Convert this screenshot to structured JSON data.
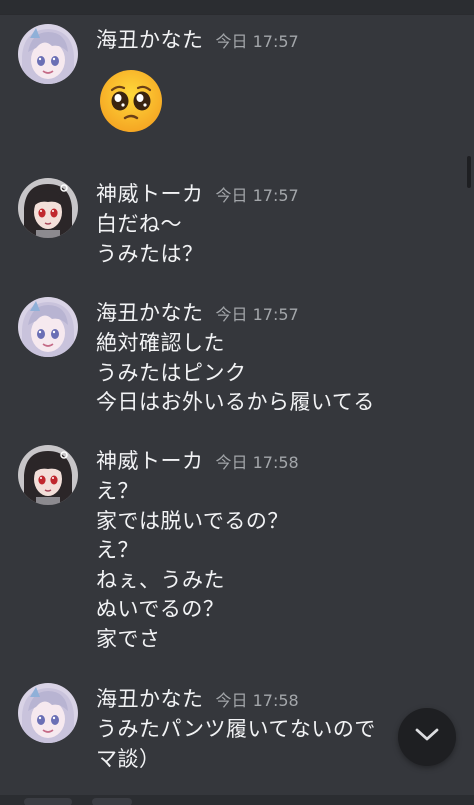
{
  "messages": [
    {
      "author": "海丑かなた",
      "time": "今日 17:57",
      "avatar": "silver-hair-avatar",
      "emoji": "pleading-face-emoji",
      "lines": []
    },
    {
      "author": "神威トーカ",
      "time": "今日 17:57",
      "avatar": "dark-hair-avatar",
      "lines": [
        "白だね〜",
        "うみたは？"
      ]
    },
    {
      "author": "海丑かなた",
      "time": "今日 17:57",
      "avatar": "silver-hair-avatar",
      "lines": [
        "絶対確認した",
        "うみたはピンク",
        "今日はお外いるから履いてる"
      ]
    },
    {
      "author": "神威トーカ",
      "time": "今日 17:58",
      "avatar": "dark-hair-avatar",
      "lines": [
        "え？",
        "家では脱いでるの？",
        "え？",
        "ねぇ、うみた",
        "ぬいでるの？",
        "家でさ"
      ]
    },
    {
      "author": "海丑かなた",
      "time": "今日 17:58",
      "avatar": "silver-hair-avatar",
      "lines": [
        "うみたパンツ履いてないので",
        "マ談）"
      ]
    }
  ],
  "controls": {
    "jump_to_present_icon": "chevron-down-icon"
  },
  "colors": {
    "background": "#35373c",
    "text": "#f2f3f5",
    "timestamp": "#a3a6aa",
    "button": "#1e1f22"
  }
}
